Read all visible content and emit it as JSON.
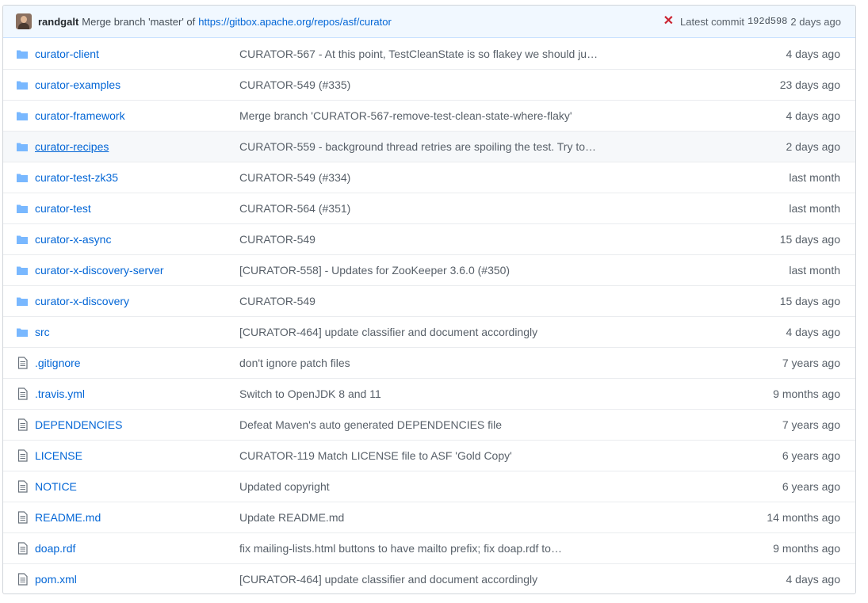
{
  "commit": {
    "author": "randgalt",
    "message": "Merge branch 'master' of",
    "link": "https://gitbox.apache.org/repos/asf/curator",
    "status_icon": "x-icon",
    "latest_label": "Latest commit",
    "sha": "192d598",
    "age": "2 days ago"
  },
  "colors": {
    "link": "#0366d6",
    "folder": "#79b8ff",
    "fail": "#cb2431"
  },
  "files": [
    {
      "type": "folder",
      "name": "curator-client",
      "message": "CURATOR-567 - At this point, TestCleanState is so flakey we should ju…",
      "age": "4 days ago"
    },
    {
      "type": "folder",
      "name": "curator-examples",
      "message": "CURATOR-549 (#335)",
      "age": "23 days ago"
    },
    {
      "type": "folder",
      "name": "curator-framework",
      "message": "Merge branch 'CURATOR-567-remove-test-clean-state-where-flaky'",
      "age": "4 days ago"
    },
    {
      "type": "folder",
      "name": "curator-recipes",
      "message": "CURATOR-559 - background thread retries are spoiling the test. Try to…",
      "age": "2 days ago"
    },
    {
      "type": "folder",
      "name": "curator-test-zk35",
      "message": "CURATOR-549 (#334)",
      "age": "last month"
    },
    {
      "type": "folder",
      "name": "curator-test",
      "message": "CURATOR-564 (#351)",
      "age": "last month"
    },
    {
      "type": "folder",
      "name": "curator-x-async",
      "message": "CURATOR-549",
      "age": "15 days ago"
    },
    {
      "type": "folder",
      "name": "curator-x-discovery-server",
      "message": "[CURATOR-558] - Updates for ZooKeeper 3.6.0 (#350)",
      "age": "last month"
    },
    {
      "type": "folder",
      "name": "curator-x-discovery",
      "message": "CURATOR-549",
      "age": "15 days ago"
    },
    {
      "type": "folder",
      "name": "src",
      "message": "[CURATOR-464] update classifier and document accordingly",
      "age": "4 days ago"
    },
    {
      "type": "file",
      "name": ".gitignore",
      "message": "don't ignore patch files",
      "age": "7 years ago"
    },
    {
      "type": "file",
      "name": ".travis.yml",
      "message": "Switch to OpenJDK 8 and 11",
      "age": "9 months ago"
    },
    {
      "type": "file",
      "name": "DEPENDENCIES",
      "message": "Defeat Maven's auto generated DEPENDENCIES file",
      "age": "7 years ago"
    },
    {
      "type": "file",
      "name": "LICENSE",
      "message": "CURATOR-119 Match LICENSE file to ASF 'Gold Copy'",
      "age": "6 years ago"
    },
    {
      "type": "file",
      "name": "NOTICE",
      "message": "Updated copyright",
      "age": "6 years ago"
    },
    {
      "type": "file",
      "name": "README.md",
      "message": "Update README.md",
      "age": "14 months ago"
    },
    {
      "type": "file",
      "name": "doap.rdf",
      "message": "fix mailing-lists.html buttons to have mailto prefix; fix doap.rdf to…",
      "age": "9 months ago"
    },
    {
      "type": "file",
      "name": "pom.xml",
      "message": "[CURATOR-464] update classifier and document accordingly",
      "age": "4 days ago"
    }
  ]
}
